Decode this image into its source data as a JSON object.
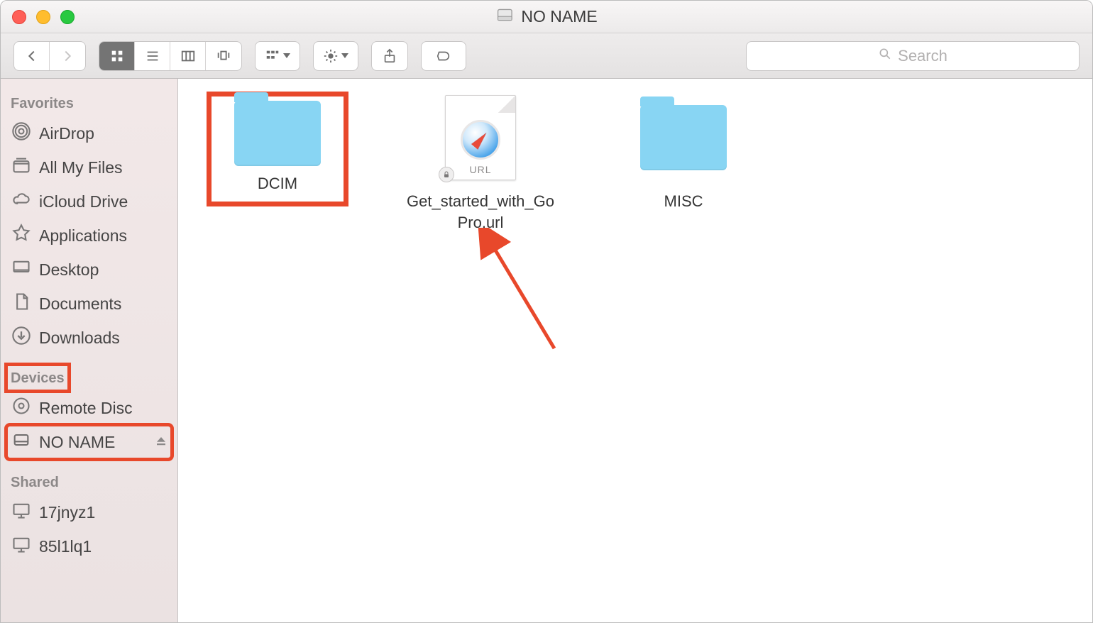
{
  "window": {
    "title": "NO NAME"
  },
  "search": {
    "placeholder": "Search"
  },
  "sidebar": {
    "sections": {
      "favorites_label": "Favorites",
      "devices_label": "Devices",
      "shared_label": "Shared"
    },
    "favorites": [
      {
        "label": "AirDrop"
      },
      {
        "label": "All My Files"
      },
      {
        "label": "iCloud Drive"
      },
      {
        "label": "Applications"
      },
      {
        "label": "Desktop"
      },
      {
        "label": "Documents"
      },
      {
        "label": "Downloads"
      }
    ],
    "devices": [
      {
        "label": "Remote Disc"
      },
      {
        "label": "NO NAME"
      }
    ],
    "shared": [
      {
        "label": "17jnyz1"
      },
      {
        "label": "85l1lq1"
      }
    ]
  },
  "content": {
    "items": [
      {
        "label": "DCIM",
        "kind": "folder",
        "highlighted": true
      },
      {
        "label": "Get_started_with_GoPro.url",
        "kind": "url",
        "badge_text": "URL"
      },
      {
        "label": "MISC",
        "kind": "folder"
      }
    ]
  },
  "annotations": {
    "highlight_color": "#e8482b",
    "arrow_from": "sidebar NO NAME",
    "arrow_to": "DCIM folder"
  }
}
